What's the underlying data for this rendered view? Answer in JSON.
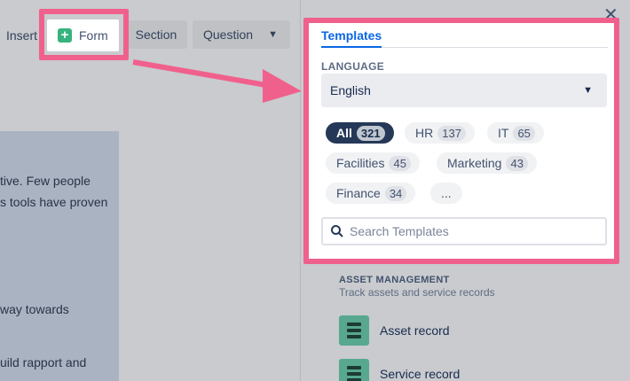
{
  "toolbar": {
    "insert_label": "Insert",
    "form_label": "Form",
    "section_label": "Section",
    "question_label": "Question"
  },
  "document": {
    "lines": [
      "tive. Few people",
      "s tools have proven",
      "way towards",
      "uild rapport and"
    ]
  },
  "panel": {
    "tab_label": "Templates",
    "language_label": "LANGUAGE",
    "language_value": "English",
    "filters": [
      {
        "label": "All",
        "count": "321",
        "active": true
      },
      {
        "label": "HR",
        "count": "137"
      },
      {
        "label": "IT",
        "count": "65"
      },
      {
        "label": "Facilities",
        "count": "45"
      },
      {
        "label": "Marketing",
        "count": "43"
      },
      {
        "label": "Finance",
        "count": "34"
      },
      {
        "label": "..."
      }
    ],
    "search_placeholder": "Search Templates"
  },
  "category": {
    "title": "ASSET MANAGEMENT",
    "description": "Track assets and service records",
    "templates": [
      {
        "label": "Asset record"
      },
      {
        "label": "Service record"
      }
    ]
  },
  "close_glyph": "✕",
  "colors": {
    "highlight": "#f0608d",
    "accent": "#0c66e4",
    "template_icon": "#57a88f",
    "plus_icon": "#36b37e"
  }
}
